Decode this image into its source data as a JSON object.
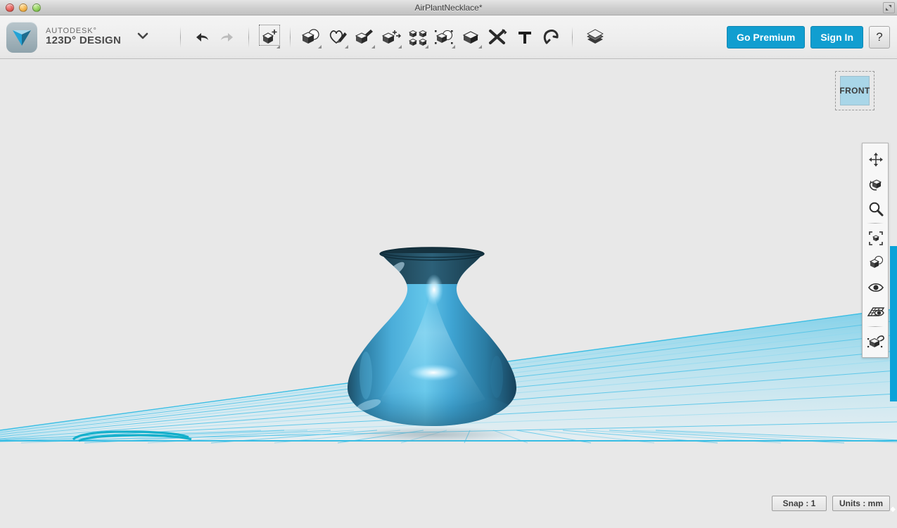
{
  "window": {
    "title": "AirPlantNecklace*",
    "controls": [
      "close",
      "minimize",
      "maximize"
    ],
    "resize_icon": "resize-icon"
  },
  "brand": {
    "logo_icon": "autodesk-123d-logo-icon",
    "line1": "AUTODESK°",
    "line2": "123D° DESIGN",
    "menu_caret_icon": "chevron-down-icon"
  },
  "toolbar": {
    "history": [
      {
        "name": "undo-button",
        "icon": "undo-arrow-icon",
        "enabled": true
      },
      {
        "name": "redo-button",
        "icon": "redo-arrow-icon",
        "enabled": false
      }
    ],
    "tools": [
      {
        "name": "transform-tool",
        "icon": "transform-cube-icon",
        "has_dropdown": true,
        "selected": true
      },
      {
        "name": "primitives-tool",
        "icon": "primitives-icon",
        "has_dropdown": true,
        "selected": false
      },
      {
        "name": "sketch-tool",
        "icon": "sketch-pencil-icon",
        "has_dropdown": true,
        "selected": false
      },
      {
        "name": "construct-tool",
        "icon": "construct-extrude-icon",
        "has_dropdown": true,
        "selected": false
      },
      {
        "name": "modify-tool",
        "icon": "modify-icon",
        "has_dropdown": true,
        "selected": false
      },
      {
        "name": "pattern-tool",
        "icon": "pattern-grid-icon",
        "has_dropdown": true,
        "selected": false
      },
      {
        "name": "grouping-tool",
        "icon": "grouping-icon",
        "has_dropdown": true,
        "selected": false
      },
      {
        "name": "combine-tool",
        "icon": "combine-cube-icon",
        "has_dropdown": true,
        "selected": false
      },
      {
        "name": "measure-tool",
        "icon": "measure-ruler-icon",
        "has_dropdown": false,
        "selected": false
      },
      {
        "name": "text-tool",
        "icon": "text-t-icon",
        "has_dropdown": false,
        "selected": false
      },
      {
        "name": "snap-tool",
        "icon": "snap-magnet-icon",
        "has_dropdown": false,
        "selected": false
      },
      {
        "name": "materials-tool",
        "icon": "materials-stack-icon",
        "has_dropdown": false,
        "selected": false
      }
    ],
    "go_premium_label": "Go Premium",
    "sign_in_label": "Sign In",
    "help_label": "?",
    "accent_color": "#119ed0"
  },
  "viewcube": {
    "face_label": "FRONT",
    "face_color": "#a9d6e8"
  },
  "nav_toolbar": {
    "items": [
      {
        "name": "pan-tool",
        "icon": "pan-arrows-icon"
      },
      {
        "name": "orbit-tool",
        "icon": "orbit-cube-icon"
      },
      {
        "name": "zoom-tool",
        "icon": "magnifier-icon"
      },
      {
        "name": "fit-tool",
        "icon": "fit-to-window-icon"
      },
      {
        "name": "view-style-tool",
        "icon": "view-cube-shaded-icon"
      },
      {
        "name": "visibility-tool",
        "icon": "eye-icon"
      },
      {
        "name": "grid-display-tool",
        "icon": "grid-eye-icon"
      },
      {
        "name": "material-paint-tool",
        "icon": "paint-cube-icon"
      }
    ]
  },
  "scene": {
    "model_name": "vase-3d-model",
    "model_color": "#3aa3d4",
    "grid_color": "#4ec3e8",
    "grid_fill": "#bfe6f4",
    "sketch_color": "#0cadc9",
    "background_color": "#e8e8e8"
  },
  "status": {
    "snap_label": "Snap : 1",
    "units_label": "Units : mm"
  }
}
